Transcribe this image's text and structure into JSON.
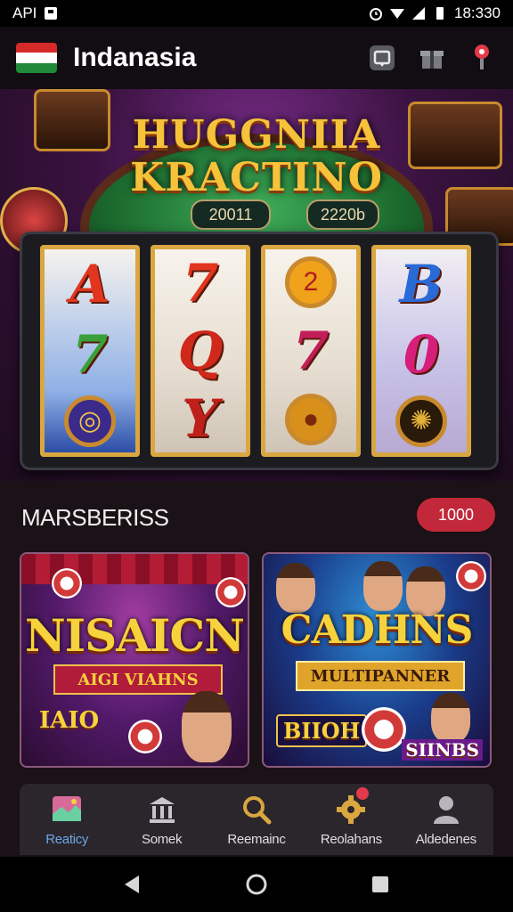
{
  "status_bar": {
    "left_text": "API",
    "time": "18:330",
    "icons": [
      "notification-icon",
      "alarm-icon",
      "wifi-icon",
      "signal-icon",
      "battery-icon"
    ]
  },
  "app_bar": {
    "title": "Indanasia",
    "icons": [
      "wallet-icon",
      "gift-icon",
      "location-pin-icon"
    ],
    "accent_color": "#e23a4a"
  },
  "hero": {
    "title_line1": "HUGGNIIA",
    "title_line2": "KRACTINO",
    "pill_left": "20011",
    "pill_right": "2220b",
    "reels": [
      [
        "A",
        "7",
        "coin"
      ],
      [
        "7",
        "Q",
        "Y"
      ],
      [
        "coin",
        "7",
        "coin"
      ],
      [
        "B",
        "0",
        "coin"
      ]
    ]
  },
  "section": {
    "title": "MARSBERISS",
    "badge": "1000"
  },
  "cards": [
    {
      "title": "NISAICN",
      "ribbon": "AIGI VIAHNS",
      "label": "IAIO"
    },
    {
      "title": "CADHNS",
      "ribbon": "MULTIPANNER",
      "label_left": "BIIOH",
      "label_right": "SIINBS"
    }
  ],
  "bottom_nav": {
    "items": [
      {
        "label": "Reaticy",
        "icon": "game-card-icon",
        "active": true
      },
      {
        "label": "Somek",
        "icon": "bank-icon",
        "active": false
      },
      {
        "label": "Reemainc",
        "icon": "search-icon",
        "active": false
      },
      {
        "label": "Reolahans",
        "icon": "gear-icon",
        "active": false
      },
      {
        "label": "Aldedenes",
        "icon": "person-icon",
        "active": false
      }
    ]
  },
  "system_nav": [
    "back-icon",
    "home-icon",
    "recents-icon"
  ]
}
